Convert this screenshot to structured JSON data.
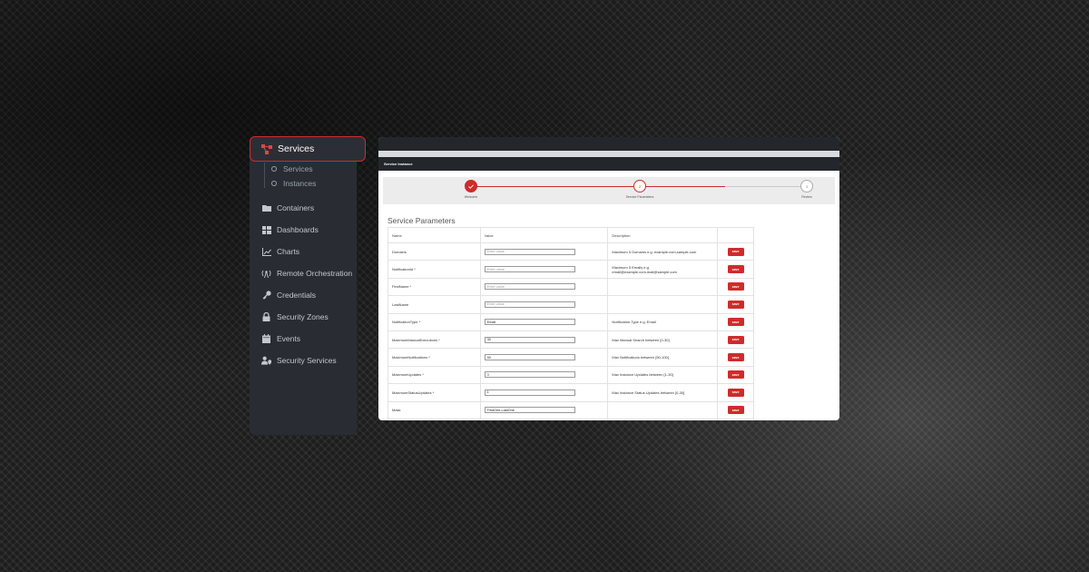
{
  "sidebar": {
    "header_label": "Services",
    "sub_items": [
      {
        "label": "Services"
      },
      {
        "label": "Instances"
      }
    ],
    "items": [
      {
        "label": "Containers",
        "icon": "folder-icon"
      },
      {
        "label": "Dashboards",
        "icon": "dashboard-grid-icon"
      },
      {
        "label": "Charts",
        "icon": "line-chart-icon"
      },
      {
        "label": "Remote Orchestration",
        "icon": "antenna-icon"
      },
      {
        "label": "Credentials",
        "icon": "key-icon"
      },
      {
        "label": "Security Zones",
        "icon": "lock-icon"
      },
      {
        "label": "Events",
        "icon": "calendar-icon"
      },
      {
        "label": "Security Services",
        "icon": "user-shield-icon"
      }
    ]
  },
  "window": {
    "title": "Service Instance",
    "steps": [
      {
        "label": "Welcome",
        "number": "1",
        "state": "done"
      },
      {
        "label": "Service Parameters",
        "number": "2",
        "state": "active"
      },
      {
        "label": "Review",
        "number": "3",
        "state": "pending"
      }
    ],
    "section_title": "Service Parameters",
    "columns": [
      "Name",
      "Value",
      "Description",
      ""
    ],
    "save_label": "save",
    "params": [
      {
        "name": "Domains",
        "value": "",
        "placeholder": "Enter value",
        "description": "Maximum 5 Domains e.g. example.com,sample.com"
      },
      {
        "name": "NotificationId *",
        "value": "",
        "placeholder": "Enter value",
        "description": "Maximum 5 Emails e.g. email@example.com,mail@sample.com"
      },
      {
        "name": "FirstName *",
        "value": "",
        "placeholder": "Enter value",
        "description": ""
      },
      {
        "name": "LastName",
        "value": "",
        "placeholder": "Enter value",
        "description": ""
      },
      {
        "name": "NotificationType *",
        "value": "Email",
        "placeholder": "",
        "description": "Notification Type e.g. Email"
      },
      {
        "name": "MaximumManualExecutions *",
        "value": "30",
        "placeholder": "",
        "description": "Max Manual Search between [0-30]"
      },
      {
        "name": "MaximumNotifications *",
        "value": "50",
        "placeholder": "",
        "description": "Max Notifications between [50-100]"
      },
      {
        "name": "MaximumUpdates *",
        "value": "0",
        "placeholder": "",
        "description": "Max Instance Updates between [1-30]"
      },
      {
        "name": "MaximumStatusUpdates *",
        "value": "1",
        "placeholder": "",
        "description": "Max Instance Status Updates between [0-30]"
      },
      {
        "name": "Mask",
        "value": "FirstOne-LastOne",
        "placeholder": "",
        "description": ""
      }
    ]
  },
  "colors": {
    "accent": "#d12a2a",
    "sidebar_bg": "#292d33",
    "window_header": "#23272c"
  }
}
